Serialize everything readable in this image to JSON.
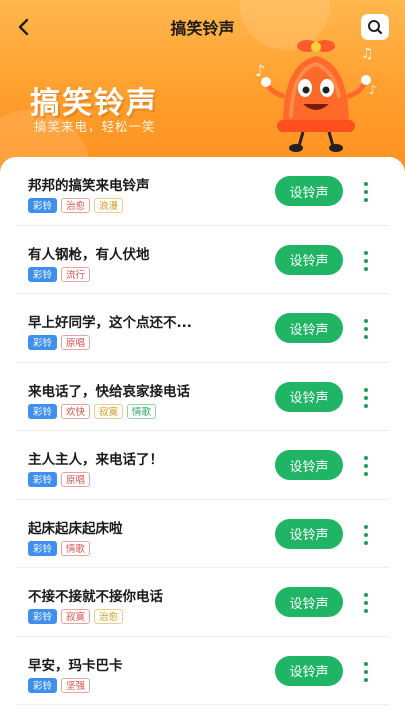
{
  "header": {
    "title": "搞笑铃声",
    "back_icon": "chevron-left-icon",
    "search_icon": "search-icon"
  },
  "hero": {
    "title": "搞笑铃声",
    "subtitle": "搞笑来电，轻松一笑",
    "mascot": "bell-mascot-illustration"
  },
  "colors": {
    "hero_orange": "#ff9c2a",
    "button_green": "#1fb564",
    "tag_blue": "#3f8ff0"
  },
  "list": {
    "button_label": "设铃声",
    "items": [
      {
        "name": "邦邦的搞笑来电铃声",
        "tags": [
          {
            "text": "彩铃",
            "style": "primary"
          },
          {
            "text": "治愈",
            "style": "red"
          },
          {
            "text": "浪漫",
            "style": "yellow"
          }
        ]
      },
      {
        "name": "有人钢枪，有人伏地",
        "tags": [
          {
            "text": "彩铃",
            "style": "primary"
          },
          {
            "text": "流行",
            "style": "red"
          }
        ]
      },
      {
        "name": "早上好同学，这个点还不...",
        "tags": [
          {
            "text": "彩铃",
            "style": "primary"
          },
          {
            "text": "原唱",
            "style": "red"
          }
        ]
      },
      {
        "name": "来电话了，快给哀家接电话",
        "tags": [
          {
            "text": "彩铃",
            "style": "primary"
          },
          {
            "text": "欢快",
            "style": "red"
          },
          {
            "text": "寂寞",
            "style": "yellow"
          },
          {
            "text": "情歌",
            "style": "green"
          }
        ]
      },
      {
        "name": "主人主人，来电话了！",
        "tags": [
          {
            "text": "彩铃",
            "style": "primary"
          },
          {
            "text": "原唱",
            "style": "red"
          }
        ]
      },
      {
        "name": "起床起床起床啦",
        "tags": [
          {
            "text": "彩铃",
            "style": "primary"
          },
          {
            "text": "情歌",
            "style": "red"
          }
        ]
      },
      {
        "name": "不接不接就不接你电话",
        "tags": [
          {
            "text": "彩铃",
            "style": "primary"
          },
          {
            "text": "寂寞",
            "style": "red"
          },
          {
            "text": "治愈",
            "style": "yellow"
          }
        ]
      },
      {
        "name": "早安，玛卡巴卡",
        "tags": [
          {
            "text": "彩铃",
            "style": "primary"
          },
          {
            "text": "坚强",
            "style": "red"
          }
        ]
      }
    ]
  }
}
